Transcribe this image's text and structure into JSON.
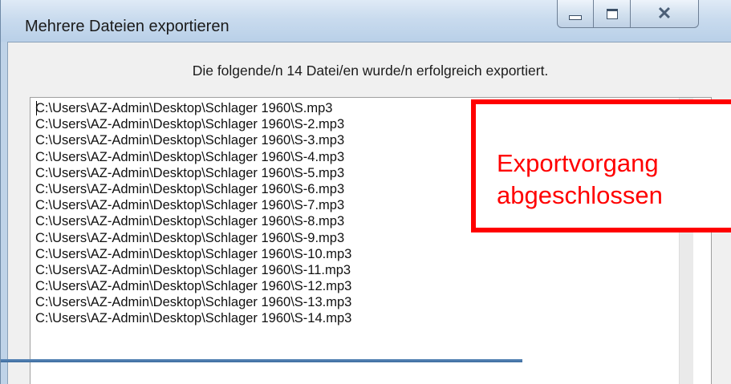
{
  "window": {
    "title": "Mehrere Dateien exportieren",
    "buttons": {
      "minimize": "minimize",
      "maximize": "maximize",
      "close": "close"
    }
  },
  "dialog": {
    "message": "Die folgende/n 14 Datei/en wurde/n erfolgreich exportiert.",
    "files": [
      "C:\\Users\\AZ-Admin\\Desktop\\Schlager 1960\\S.mp3",
      "C:\\Users\\AZ-Admin\\Desktop\\Schlager 1960\\S-2.mp3",
      "C:\\Users\\AZ-Admin\\Desktop\\Schlager 1960\\S-3.mp3",
      "C:\\Users\\AZ-Admin\\Desktop\\Schlager 1960\\S-4.mp3",
      "C:\\Users\\AZ-Admin\\Desktop\\Schlager 1960\\S-5.mp3",
      "C:\\Users\\AZ-Admin\\Desktop\\Schlager 1960\\S-6.mp3",
      "C:\\Users\\AZ-Admin\\Desktop\\Schlager 1960\\S-7.mp3",
      "C:\\Users\\AZ-Admin\\Desktop\\Schlager 1960\\S-8.mp3",
      "C:\\Users\\AZ-Admin\\Desktop\\Schlager 1960\\S-9.mp3",
      "C:\\Users\\AZ-Admin\\Desktop\\Schlager 1960\\S-10.mp3",
      "C:\\Users\\AZ-Admin\\Desktop\\Schlager 1960\\S-11.mp3",
      "C:\\Users\\AZ-Admin\\Desktop\\Schlager 1960\\S-12.mp3",
      "C:\\Users\\AZ-Admin\\Desktop\\Schlager 1960\\S-13.mp3",
      "C:\\Users\\AZ-Admin\\Desktop\\Schlager 1960\\S-14.mp3"
    ]
  },
  "callout": {
    "text": "Exportvorgang\nabgeschlossen",
    "color": "#ff0000"
  },
  "colors": {
    "titlebar": "#c9dbee",
    "client": "#f0f0f0",
    "accent_red": "#ff0000"
  }
}
